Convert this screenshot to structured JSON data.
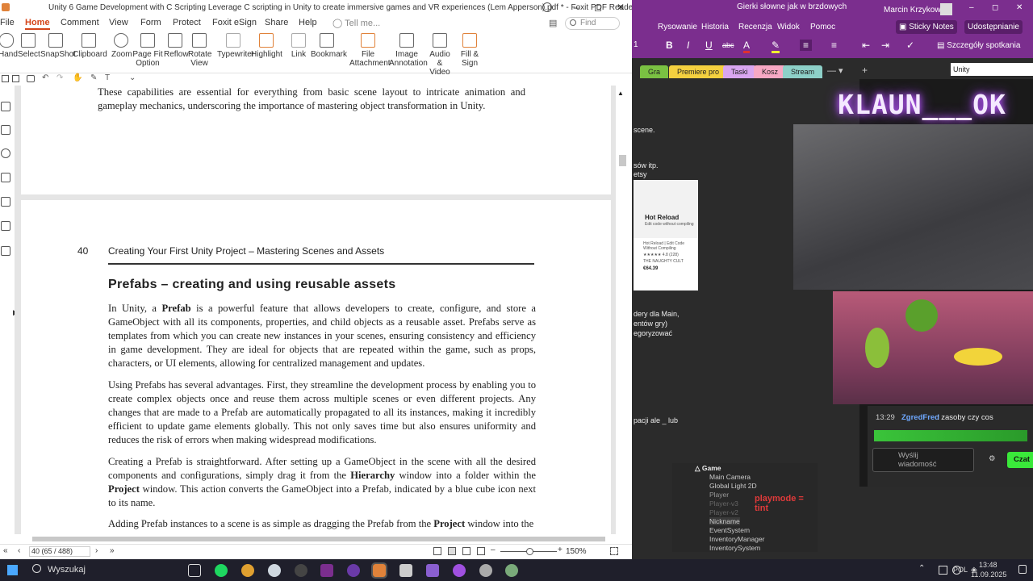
{
  "foxit": {
    "title": "Unity 6 Game Development with C Scripting Leverage C scripting in Unity to create immersive games and VR experiences (Lem Apperson).pdf * - Foxit PDF Reader",
    "menu": [
      "File",
      "Home",
      "Comment",
      "View",
      "Form",
      "Protect",
      "Foxit eSign",
      "Share",
      "Help"
    ],
    "active_menu": "Home",
    "tell_me": "Tell me...",
    "find": "Find",
    "ribbon": [
      {
        "l1": "Hand",
        "l2": ""
      },
      {
        "l1": "Select",
        "l2": ""
      },
      {
        "l1": "SnapShot",
        "l2": ""
      },
      {
        "l1": "Clipboard",
        "l2": ""
      },
      {
        "l1": "Zoom",
        "l2": ""
      },
      {
        "l1": "Page Fit",
        "l2": "Option"
      },
      {
        "l1": "Reflow",
        "l2": ""
      },
      {
        "l1": "Rotate",
        "l2": "View"
      },
      {
        "l1": "Typewriter",
        "l2": ""
      },
      {
        "l1": "Highlight",
        "l2": ""
      },
      {
        "l1": "Link",
        "l2": ""
      },
      {
        "l1": "Bookmark",
        "l2": ""
      },
      {
        "l1": "File",
        "l2": "Attachment"
      },
      {
        "l1": "Image",
        "l2": "Annotation"
      },
      {
        "l1": "Audio",
        "l2": "& Video"
      },
      {
        "l1": "Fill &",
        "l2": "Sign"
      }
    ],
    "page_prev_text": "These capabilities are essential for everything from basic scene layout to intricate animation and gameplay mechanics, underscoring the importance of mastering object transformation in Unity.",
    "page_number": "40",
    "page_header": "Creating Your First Unity Project – Mastering Scenes and Assets",
    "heading": "Prefabs – creating and using reusable assets",
    "para1_pre": "In Unity, a ",
    "para1_bold": "Prefab",
    "para1_post": " is a powerful feature that allows developers to create, configure, and store a GameObject with all its components, properties, and child objects as a reusable asset. Prefabs serve as templates from which you can create new instances in your scenes, ensuring consistency and efficiency in game development. They are ideal for objects that are repeated within the game, such as props, characters, or UI elements, allowing for centralized management and updates.",
    "para2": "Using Prefabs has several advantages. First, they streamline the development process by enabling you to create complex objects once and reuse them across multiple scenes or even different projects. Any changes that are made to a Prefab are automatically propagated to all its instances, making it incredibly efficient to update game elements globally. This not only saves time but also ensures uniformity and reduces the risk of errors when making widespread modifications.",
    "para3_a": "Creating a Prefab is straightforward. After setting up a GameObject in the scene with all the desired components and configurations, simply drag it from the ",
    "para3_b": "Hierarchy",
    "para3_c": " window into a folder within the ",
    "para3_d": "Project",
    "para3_e": " window. This action converts the GameObject into a Prefab, indicated by a blue cube icon next to its name.",
    "para4_a": "Adding Prefab instances to a scene is as simple as dragging the Prefab from the ",
    "para4_b": "Project",
    "para4_c": " window into the",
    "page_field": "40 (65 / 488)",
    "zoom": "150%"
  },
  "onenote": {
    "title": "Gierki słowne jak w brzdowych",
    "user": "Marcin Krzykowski",
    "menu": [
      "Rysowanie",
      "Historia",
      "Recenzja",
      "Widok",
      "Pomoc"
    ],
    "sticky": "Sticky Notes",
    "share": "Udostępnianie",
    "meeting": "Szczegóły spotkania",
    "font_size": "1",
    "search_text": "Unity",
    "tabs": [
      {
        "label": "Gra",
        "color": "#7ac142"
      },
      {
        "label": "Premiere pro",
        "color": "#f4d03f"
      },
      {
        "label": "Taski",
        "color": "#d9a6f0"
      },
      {
        "label": "Kosz",
        "color": "#f7a8c4"
      },
      {
        "label": "Stream",
        "color": "#8dd0c8"
      }
    ],
    "snippets": [
      "scene.",
      "sów itp.",
      "etsy",
      "dery dla Main,",
      "entów gry)",
      "egoryzować",
      "pacji ale _ lub"
    ]
  },
  "hotreload": {
    "title": "Hot Reload",
    "subtitle": "Edit code without compiling",
    "desc": "Hot Reload | Edit Code Without Compiling",
    "rating": "★★★★★ 4.8 (228)",
    "vendor": "THE NAUGHTY CULT",
    "price": "€64.39"
  },
  "stream": {
    "title": "KLAUN___OK",
    "chat_time": "13:29",
    "chat_user": "ZgredFred",
    "chat_msg": ": zasoby czy cos",
    "chat_placeholder": "Wyślij wiadomość",
    "chat_button": "Czat"
  },
  "hierarchy": {
    "root": "Game",
    "items": [
      "Main Camera",
      "Global Light 2D",
      "Player",
      "Player-v3",
      "Player-v2",
      "Nickname",
      "EventSystem",
      "InventoryManager",
      "InventorySystem"
    ],
    "note": "playmode = tint"
  },
  "taskbar": {
    "search": "Wyszukaj",
    "lang": "POL",
    "time": "13:48",
    "date": "11.09.2025"
  }
}
